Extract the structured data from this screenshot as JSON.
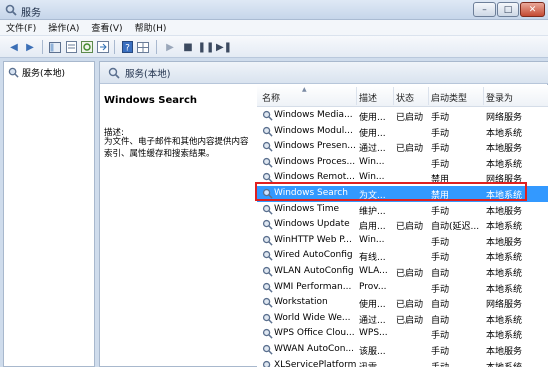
{
  "window": {
    "title": "服务"
  },
  "menu": [
    "文件(F)",
    "操作(A)",
    "查看(V)",
    "帮助(H)"
  ],
  "tree": {
    "root": "服务(本地)"
  },
  "main": {
    "header": "服务(本地)",
    "detail": {
      "title": "Windows Search",
      "desc_label": "描述:",
      "desc_text": "为文件、电子邮件和其他内容提供内容索引、属性缓存和搜索结果。"
    }
  },
  "columns": [
    "名称",
    "描述",
    "状态",
    "启动类型",
    "登录为"
  ],
  "services": [
    {
      "name": "Windows Media...",
      "desc": "使用...",
      "state": "已启动",
      "start": "手动",
      "logon": "网络服务"
    },
    {
      "name": "Windows Modul...",
      "desc": "使用...",
      "state": "",
      "start": "手动",
      "logon": "本地系统"
    },
    {
      "name": "Windows Presen...",
      "desc": "通过...",
      "state": "已启动",
      "start": "手动",
      "logon": "本地服务"
    },
    {
      "name": "Windows Proces...",
      "desc": "Win...",
      "state": "",
      "start": "手动",
      "logon": "本地系统"
    },
    {
      "name": "Windows Remot...",
      "desc": "Win...",
      "state": "",
      "start": "禁用",
      "logon": "网络服务"
    },
    {
      "name": "Windows Search",
      "desc": "为文...",
      "state": "",
      "start": "禁用",
      "logon": "本地系统",
      "selected": true
    },
    {
      "name": "Windows Time",
      "desc": "维护...",
      "state": "",
      "start": "手动",
      "logon": "本地服务"
    },
    {
      "name": "Windows Update",
      "desc": "启用...",
      "state": "已启动",
      "start": "自动(延迟...",
      "logon": "本地系统"
    },
    {
      "name": "WinHTTP Web P...",
      "desc": "Win...",
      "state": "",
      "start": "手动",
      "logon": "本地服务"
    },
    {
      "name": "Wired AutoConfig",
      "desc": "有线...",
      "state": "",
      "start": "手动",
      "logon": "本地系统"
    },
    {
      "name": "WLAN AutoConfig",
      "desc": "WLA...",
      "state": "已启动",
      "start": "自动",
      "logon": "本地系统"
    },
    {
      "name": "WMI Performan...",
      "desc": "Prov...",
      "state": "",
      "start": "手动",
      "logon": "本地系统"
    },
    {
      "name": "Workstation",
      "desc": "使用...",
      "state": "已启动",
      "start": "自动",
      "logon": "网络服务"
    },
    {
      "name": "World Wide We...",
      "desc": "通过...",
      "state": "已启动",
      "start": "自动",
      "logon": "本地系统"
    },
    {
      "name": "WPS Office Clou...",
      "desc": "WPS...",
      "state": "",
      "start": "手动",
      "logon": "本地系统"
    },
    {
      "name": "WWAN AutoCon...",
      "desc": "该服...",
      "state": "",
      "start": "手动",
      "logon": "本地服务"
    },
    {
      "name": "XLServicePlatform",
      "desc": "迅雷...",
      "state": "",
      "start": "手动",
      "logon": "本地系统"
    }
  ],
  "colors": {
    "selection": "#3399ff",
    "highlight_outline": "#e02020"
  },
  "icons": [
    "services-app-icon",
    "minimize-icon",
    "maximize-icon",
    "close-icon",
    "gear-icon"
  ]
}
